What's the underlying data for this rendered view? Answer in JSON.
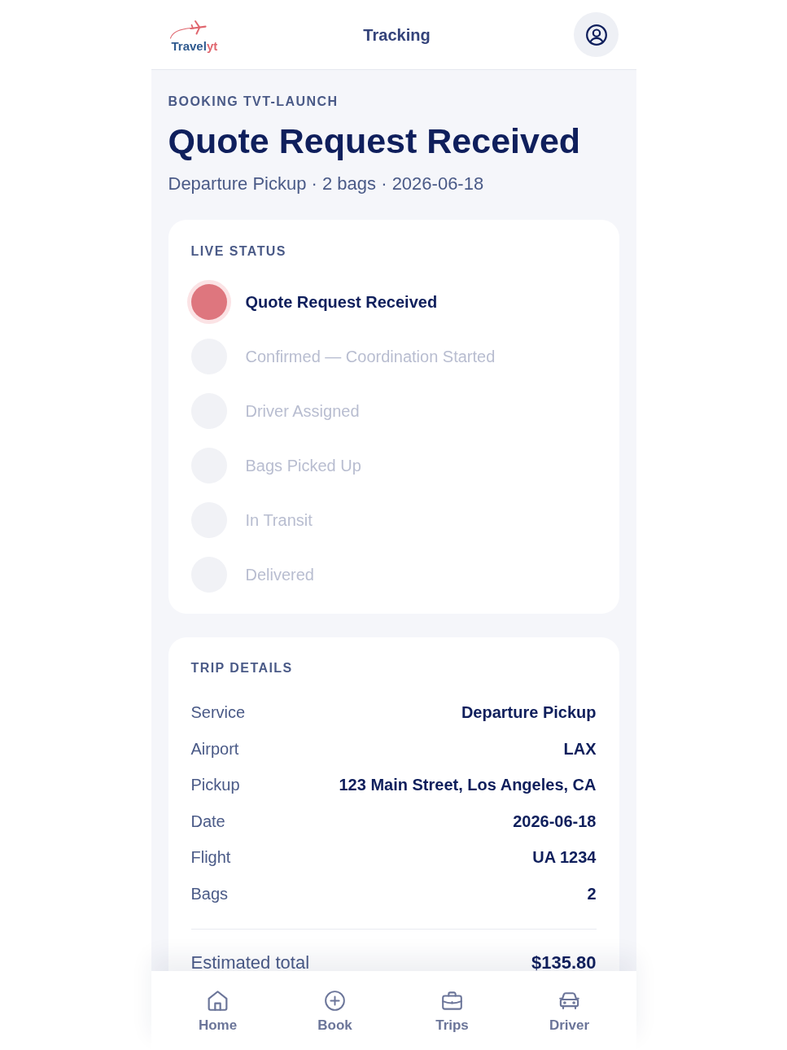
{
  "header": {
    "logo": {
      "brand": "Travel",
      "accent": "yt"
    },
    "title": "Tracking"
  },
  "booking": {
    "eyebrow": "BOOKING TVT-LAUNCH",
    "title": "Quote Request Received",
    "subtitle": "Departure Pickup · 2 bags · 2026-06-18"
  },
  "live_status": {
    "heading": "LIVE STATUS",
    "steps": [
      {
        "label": "Quote Request Received",
        "current": true
      },
      {
        "label": "Confirmed — Coordination Started",
        "current": false
      },
      {
        "label": "Driver Assigned",
        "current": false
      },
      {
        "label": "Bags Picked Up",
        "current": false
      },
      {
        "label": "In Transit",
        "current": false
      },
      {
        "label": "Delivered",
        "current": false
      }
    ]
  },
  "trip_details": {
    "heading": "TRIP DETAILS",
    "rows": [
      {
        "label": "Service",
        "value": "Departure Pickup"
      },
      {
        "label": "Airport",
        "value": "LAX"
      },
      {
        "label": "Pickup",
        "value": "123 Main Street, Los Angeles, CA"
      },
      {
        "label": "Date",
        "value": "2026-06-18"
      },
      {
        "label": "Flight",
        "value": "UA 1234"
      },
      {
        "label": "Bags",
        "value": "2"
      }
    ],
    "total": {
      "label": "Estimated total",
      "value": "$135.80"
    }
  },
  "bottom_nav": {
    "items": [
      {
        "label": "Home"
      },
      {
        "label": "Book"
      },
      {
        "label": "Trips"
      },
      {
        "label": "Driver"
      }
    ]
  }
}
